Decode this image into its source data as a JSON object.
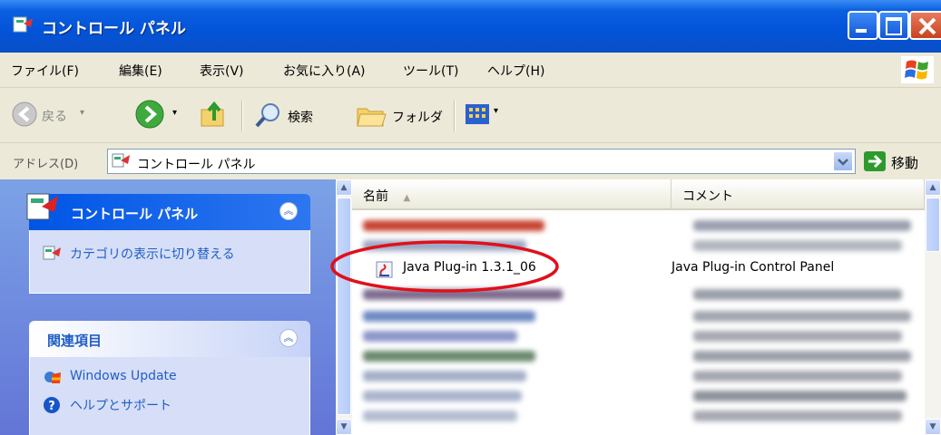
{
  "window": {
    "title": "コントロール パネル"
  },
  "menu": [
    "ファイル(F)",
    "編集(E)",
    "表示(V)",
    "お気に入り(A)",
    "ツール(T)",
    "ヘルプ(H)"
  ],
  "toolbar": {
    "back": "戻る",
    "search": "検索",
    "folders": "フォルダ"
  },
  "address": {
    "label": "アドレス(D)",
    "value": "コントロール パネル",
    "go": "移動"
  },
  "left": {
    "cp_title": "コントロール パネル",
    "switch_view": "カテゴリの表示に切り替える",
    "related_title": "関連項目",
    "links": [
      "Windows Update",
      "ヘルプとサポート"
    ]
  },
  "list": {
    "col_name": "名前",
    "col_comment": "コメント",
    "highlight": {
      "name": "Java Plug-in 1.3.1_06",
      "comment": "Java Plug-in Control Panel"
    }
  },
  "colors": {
    "title_blue": "#0353D8",
    "annotation": "#E0101A"
  }
}
